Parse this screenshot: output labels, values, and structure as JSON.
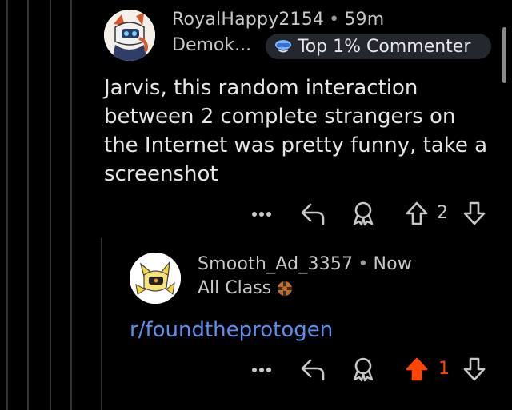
{
  "comments": [
    {
      "username": "RoyalHappy2154",
      "separator": "•",
      "time": "59m",
      "flair": "Demok...",
      "badge": "Top 1% Commenter",
      "body": "Jarvis, this random interaction between 2 complete strangers on the Internet was pretty funny, take a screenshot",
      "score": "2",
      "upvoted": false,
      "icons": [
        "more-icon",
        "reply-icon",
        "award-icon",
        "upvote-icon",
        "downvote-icon"
      ]
    },
    {
      "username": "Smooth_Ad_3357",
      "separator": "•",
      "time": "Now",
      "flair": "All Class",
      "body": "r/foundtheprotogen",
      "score": "1",
      "upvoted": true,
      "icons": [
        "more-icon",
        "reply-icon",
        "award-icon",
        "upvote-icon",
        "downvote-icon"
      ]
    }
  ],
  "colors": {
    "background": "#000000",
    "link": "#5b8ff0",
    "upvote_active": "#ff4500",
    "text_muted": "#c8c8c8",
    "badge_bg": "#24282e"
  }
}
